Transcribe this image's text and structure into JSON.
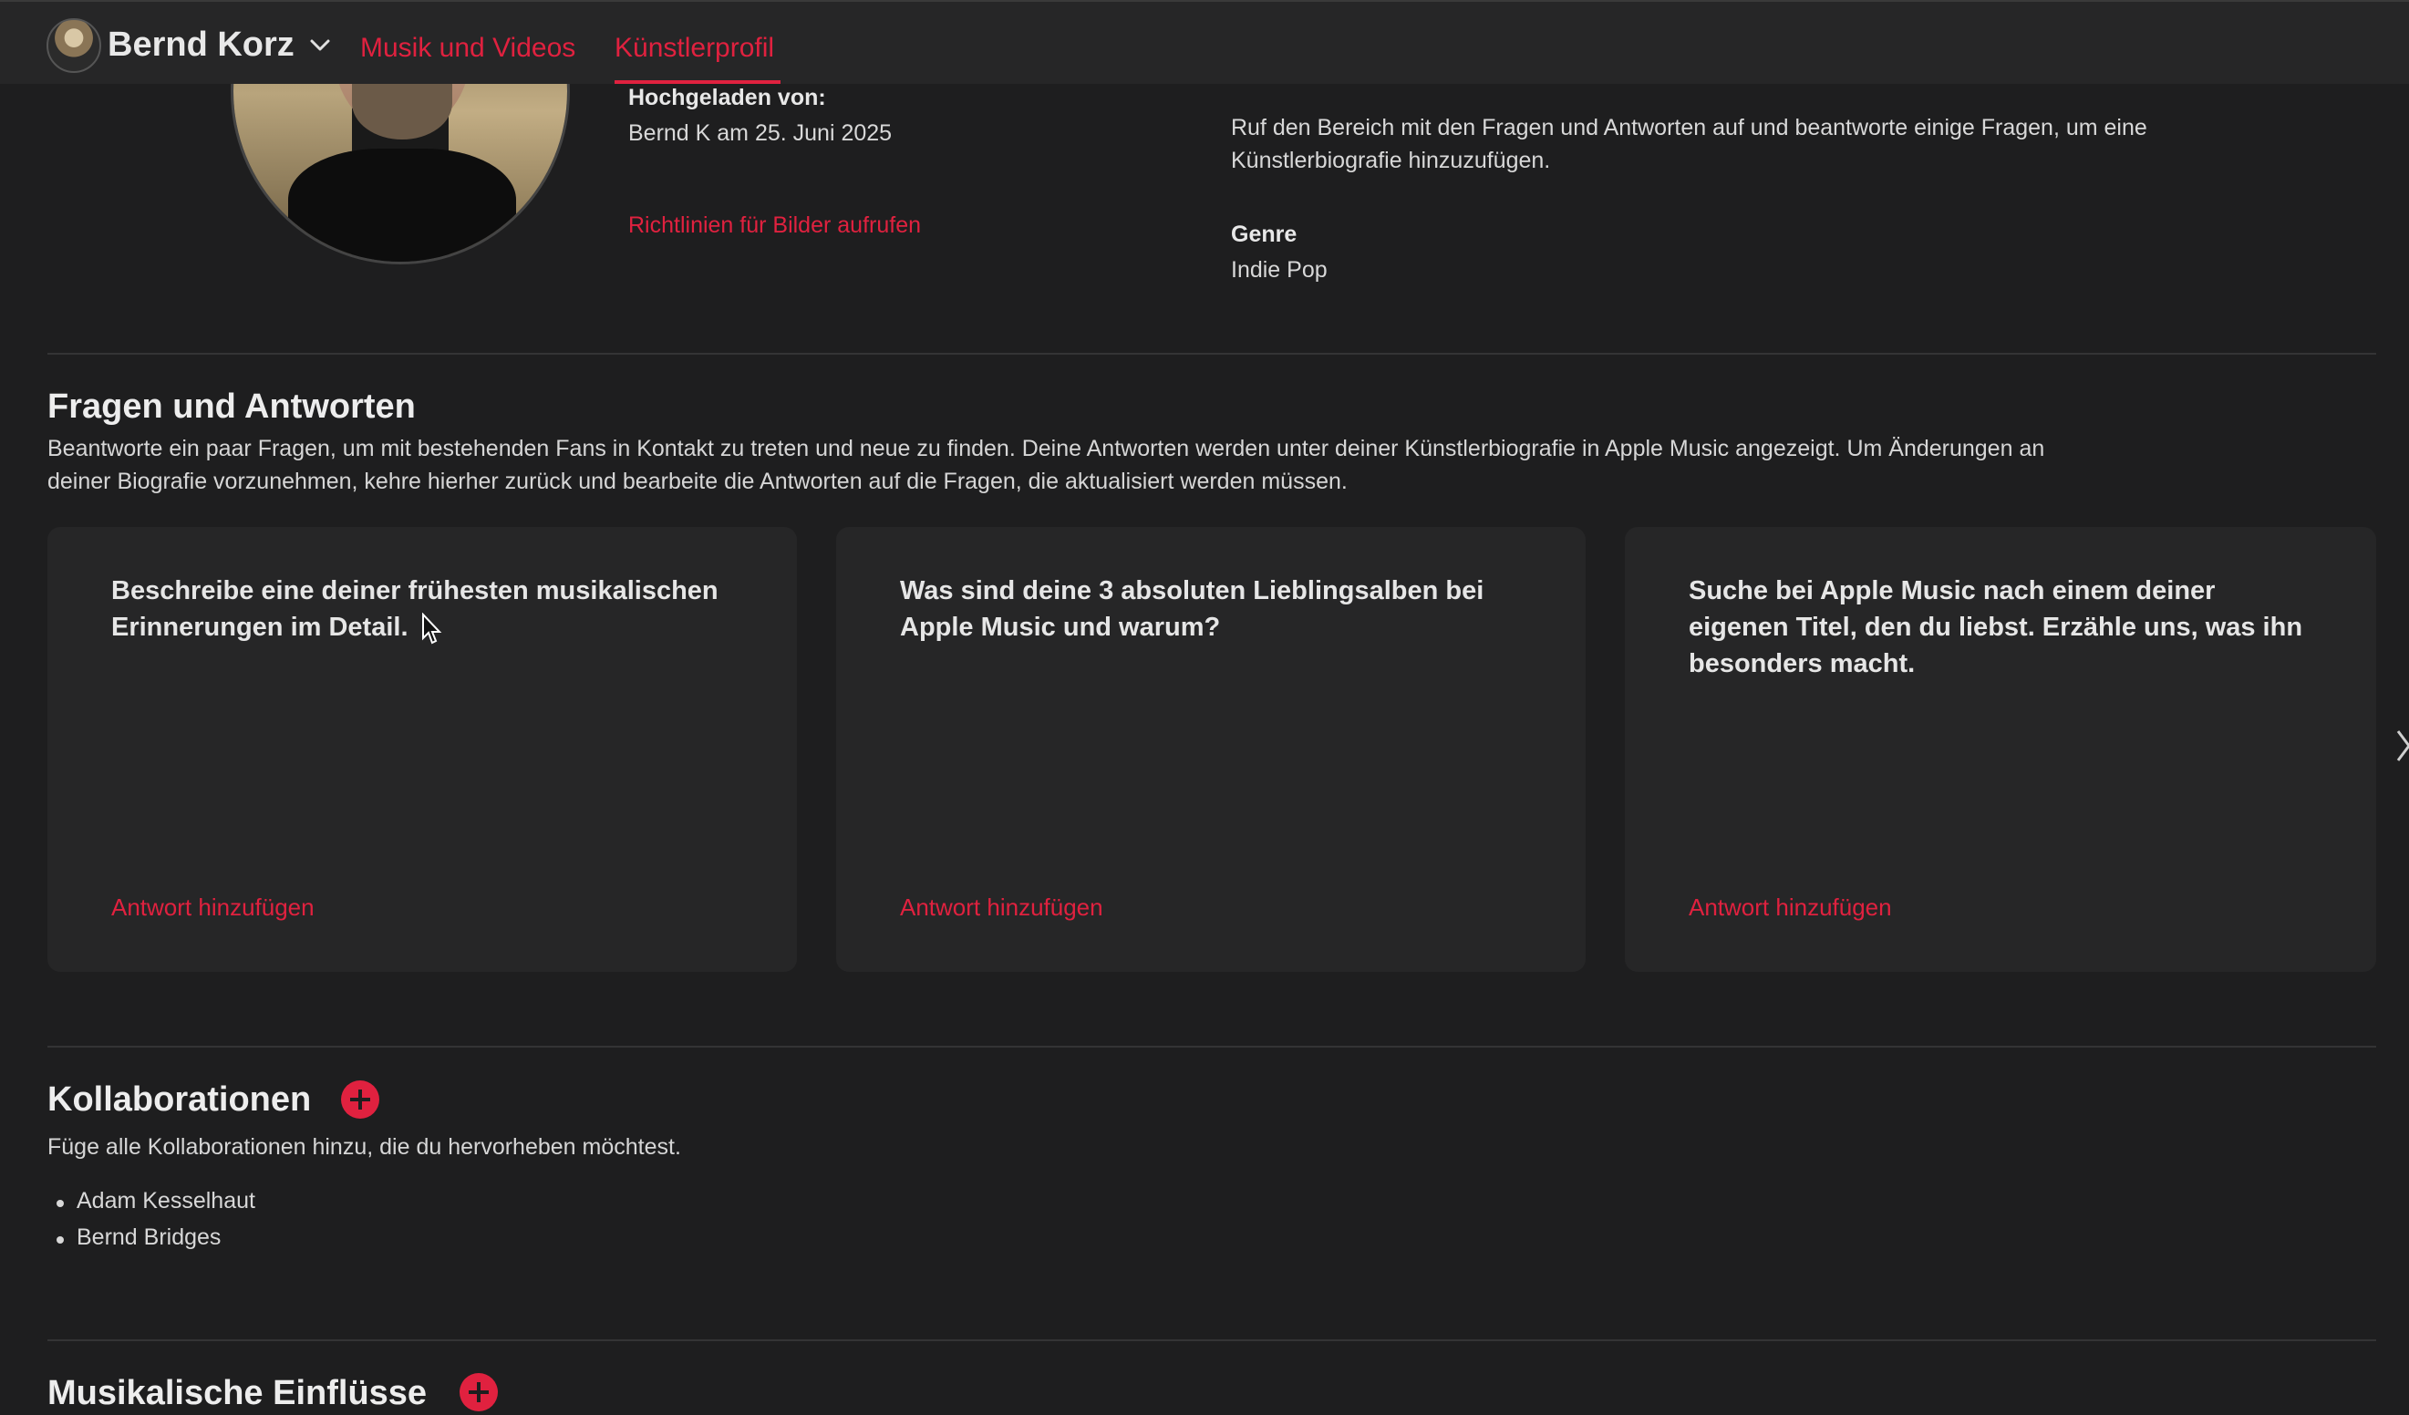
{
  "header": {
    "user_name": "Bernd Korz",
    "tabs": [
      "Musik und Videos",
      "Künstlerprofil"
    ],
    "accent": "#e0213f"
  },
  "profile": {
    "uploaded_label": "Hochgeladen von:",
    "uploaded_value": "Bernd K am 25. Juni 2025",
    "image_guidelines_link": "Richtlinien für Bilder aufrufen",
    "bio_hint_line1": "Ruf den Bereich mit den Fragen und Antworten auf und beantworte einige Fragen, um eine",
    "bio_hint_line2": "Künstlerbiografie hinzuzufügen.",
    "genre_label": "Genre",
    "genre_value": "Indie Pop"
  },
  "qa": {
    "title": "Fragen und Antworten",
    "desc_line1": "Beantworte ein paar Fragen, um mit bestehenden Fans in Kontakt zu treten und neue zu finden. Deine Antworten werden unter deiner Künstlerbiografie in Apple Music angezeigt. Um Änderungen an",
    "desc_line2": "deiner Biografie vorzunehmen, kehre hierher zurück und bearbeite die Antworten auf die Fragen, die aktualisiert werden müssen.",
    "cards": [
      {
        "question": "Beschreibe eine deiner frühesten musikalischen Erinnerungen im Detail.",
        "action": "Antwort hinzufügen"
      },
      {
        "question": "Was sind deine 3 absoluten Lieblingsalben bei Apple Music und warum?",
        "action": "Antwort hinzufügen"
      },
      {
        "question": "Suche bei Apple Music nach einem deiner eigenen Titel, den du liebst. Erzähle uns, was ihn besonders macht.",
        "action": "Antwort hinzufügen"
      }
    ]
  },
  "collaborations": {
    "title": "Kollaborationen",
    "desc": "Füge alle Kollaborationen hinzu, die du hervorheben möchtest.",
    "items": [
      "Adam Kesselhaut",
      "Bernd Bridges"
    ]
  },
  "influences": {
    "title": "Musikalische Einflüsse"
  }
}
